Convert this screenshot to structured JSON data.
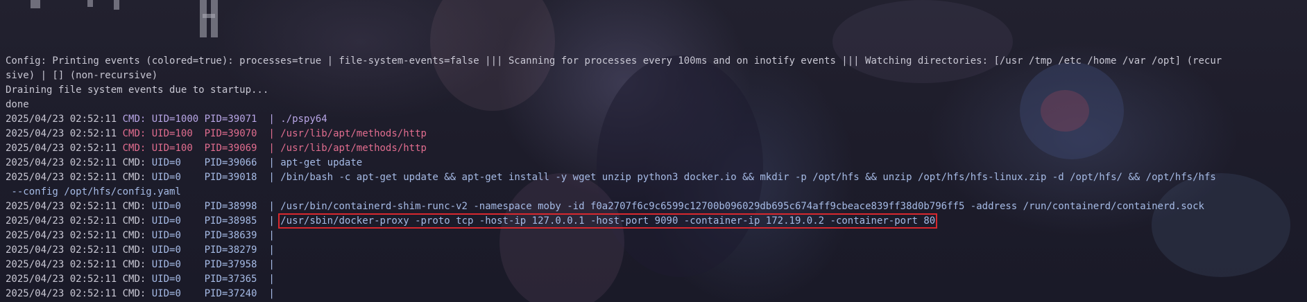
{
  "header": {
    "line1": "Config: Printing events (colored=true): processes=true | file-system-events=false ||| Scanning for processes every 100ms and on inotify events ||| Watching directories: [/usr /tmp /etc /home /var /opt] (recur",
    "line2": "sive) | [] (non-recursive)",
    "line3": "Draining file system events due to startup...",
    "line4": "done"
  },
  "colors": {
    "default": "#c9c8d4",
    "user_process": "#b8a6e6",
    "uid_100": "#e26d8f",
    "root_process": "#a6bbe6",
    "highlight_box": "#d8282e"
  },
  "events": [
    {
      "ts": "2025/04/23 02:52:11",
      "uid": "UID=1000",
      "pid": "PID=39071",
      "sep": "|",
      "cmd": "./pspy64",
      "style": "user"
    },
    {
      "ts": "2025/04/23 02:52:11",
      "uid": "UID=100 ",
      "pid": "PID=39070",
      "sep": "|",
      "cmd": "/usr/lib/apt/methods/http",
      "style": "pink"
    },
    {
      "ts": "2025/04/23 02:52:11",
      "uid": "UID=100 ",
      "pid": "PID=39069",
      "sep": "|",
      "cmd": "/usr/lib/apt/methods/http",
      "style": "pink"
    },
    {
      "ts": "2025/04/23 02:52:11",
      "uid": "UID=0   ",
      "pid": "PID=39066",
      "sep": "|",
      "cmd": "apt-get update",
      "style": "root"
    },
    {
      "ts": "2025/04/23 02:52:11",
      "uid": "UID=0   ",
      "pid": "PID=39018",
      "sep": "|",
      "cmd": "/bin/bash -c apt-get update && apt-get install -y wget unzip python3 docker.io && mkdir -p /opt/hfs && unzip /opt/hfs/hfs-linux.zip -d /opt/hfs/ && /opt/hfs/hfs",
      "style": "root",
      "wrap": " --config /opt/hfs/config.yaml"
    },
    {
      "ts": "2025/04/23 02:52:11",
      "uid": "UID=0   ",
      "pid": "PID=38998",
      "sep": "|",
      "cmd": "/usr/bin/containerd-shim-runc-v2 -namespace moby -id f0a2707f6c9c6599c12700b096029db695c674aff9cbeace839ff38d0b796ff5 -address /run/containerd/containerd.sock",
      "style": "root"
    },
    {
      "ts": "2025/04/23 02:52:11",
      "uid": "UID=0   ",
      "pid": "PID=38985",
      "sep": "|",
      "cmd": "/usr/sbin/docker-proxy -proto tcp -host-ip 127.0.0.1 -host-port 9090 -container-ip 172.19.0.2 -container-port 80",
      "style": "root",
      "highlight": true
    },
    {
      "ts": "2025/04/23 02:52:11",
      "uid": "UID=0   ",
      "pid": "PID=38639",
      "sep": "|",
      "cmd": "",
      "style": "root"
    },
    {
      "ts": "2025/04/23 02:52:11",
      "uid": "UID=0   ",
      "pid": "PID=38279",
      "sep": "|",
      "cmd": "",
      "style": "root"
    },
    {
      "ts": "2025/04/23 02:52:11",
      "uid": "UID=0   ",
      "pid": "PID=37958",
      "sep": "|",
      "cmd": "",
      "style": "root"
    },
    {
      "ts": "2025/04/23 02:52:11",
      "uid": "UID=0   ",
      "pid": "PID=37365",
      "sep": "|",
      "cmd": "",
      "style": "root"
    },
    {
      "ts": "2025/04/23 02:52:11",
      "uid": "UID=0   ",
      "pid": "PID=37240",
      "sep": "|",
      "cmd": "",
      "style": "root"
    }
  ],
  "labels": {
    "cmd_prefix": "CMD:"
  }
}
